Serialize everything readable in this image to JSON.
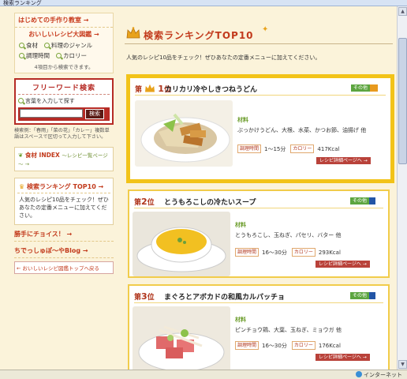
{
  "window": {
    "title": "検索ランキング"
  },
  "status": {
    "zone": "インターネット"
  },
  "sidebar": {
    "first_time": "はじめての手作り教室 →",
    "recipe_menu_title": "おいしいレシピ大図鑑 →",
    "menu_items": [
      "食材",
      "料理のジャンル",
      "調理時間",
      "カロリー"
    ],
    "menu_note": "4項目から検索できます。",
    "freeword_title": "フリーワード検索",
    "freeword_sub": "言葉を入力して探す",
    "search_button": "検索",
    "freeword_note": "検索例：「春雨」「菜の花」「カレー」複数単語はスペースで区切って入力して下さい。",
    "index_label": "食材 INDEX",
    "index_sub": "～レシピ一覧ページ～ →",
    "ranking_title": "検索ランキング TOP10 →",
    "ranking_desc": "人気のレシピ10品をチェック！ぜひあなたの定番メニューに加えてください。",
    "choice_link": "勝手にチョイス！ →",
    "blog_link": "ちでっしゅぽ～やBlog →",
    "back_link": "← おいしいレシピ図鑑トップへ戻る"
  },
  "main": {
    "title": "検索ランキングTOP10",
    "intro": "人気のレシピ10品をチェック！ぜひあなたの定番メニューに加えてください。",
    "labels": {
      "ingredients": "材料",
      "time": "調理時間",
      "calorie": "カロリー",
      "detail": "レシピ詳細ページへ →",
      "tag_other": "その他"
    },
    "cards": [
      {
        "rank_prefix": "第",
        "rank_num": "1",
        "rank_suffix": "位",
        "name": "カリカリ冷やしきつねうどん",
        "ingredients": "ぶっかけうどん、大根、水菜、かつお節、油揚げ 他",
        "time": "1～15分",
        "calorie": "417Kcal"
      },
      {
        "rank_prefix": "第",
        "rank_num": "2",
        "rank_suffix": "位",
        "name": "とうもろこしの冷たいスープ",
        "ingredients": "とうもろこし、玉ねぎ、パセリ、バター 他",
        "time": "16～30分",
        "calorie": "293Kcal"
      },
      {
        "rank_prefix": "第",
        "rank_num": "3",
        "rank_suffix": "位",
        "name": "まぐろとアボカドの和風カルパッチョ",
        "ingredients": "ピンチョウ鶏、大葉、玉ねぎ、ミョウガ 他",
        "time": "16～30分",
        "calorie": "176Kcal"
      }
    ]
  },
  "colors": {
    "accent": "#c23a1c",
    "gold_border": "#f2c318",
    "green_tag": "#5ca53f"
  }
}
